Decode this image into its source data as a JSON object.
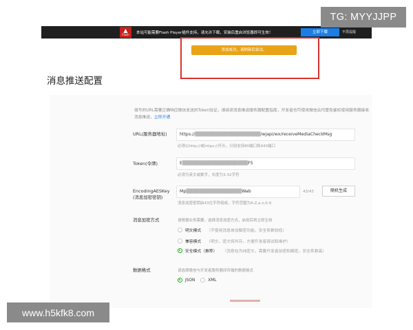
{
  "topbar": {
    "badge_label": "Flash",
    "message": "本站可能需要Flash Player插件支持，请允许下载，安装后重启浏览器即可生效！",
    "update_button": "立即下载",
    "no_remind": "不再提醒"
  },
  "watermark_top": "TG: MYYJJPP",
  "watermark_bottom": "www.h5kfk8.com",
  "notice": "添加成功，请刷新后尝试。",
  "page_title": "消息推送配置",
  "intro": {
    "text": "填写的URL需要正确响应微信发送的Token验证，请阅读消息推送服务器配置指南，开发者也可使用微信云托管免鉴权使用服务器接收消息推送，",
    "link": "立即开通"
  },
  "form": {
    "url": {
      "label": "URL(服务器地址)",
      "value_prefix": "https://",
      "value_suffix": "/wjapi/wx/receiveMediaCheckMsg",
      "hint": "必须以http://或https://开头，分别支持80端口和443端口"
    },
    "token": {
      "label": "Token(令牌)",
      "value_prefix": "E",
      "value_suffix": "F5",
      "hint": "必须为英文或数字，长度为3-32字符"
    },
    "aeskey": {
      "label_line1": "EncodingAESKey",
      "label_line2": "(消息加密密钥)",
      "value_prefix": "Mp",
      "value_suffix": "Wab",
      "counter": "43/43",
      "generate_button": "随机生成",
      "hint": "消息加密密钥由43位字符组成，字符范围为A-Z,a-z,0-9"
    },
    "encrypt_mode": {
      "label": "消息加密方式",
      "hint": "请根据业务需要，选择消息加密方式，启用后将立即生效",
      "options": [
        {
          "name": "明文模式",
          "desc": "（不使用消息体加解密功能，安全系数较低）",
          "selected": false
        },
        {
          "name": "兼容模式",
          "desc": "（明文、密文将共存，方便开发者调试和维护）",
          "selected": false
        },
        {
          "name": "安全模式（推荐）",
          "desc": "（消息包为纯密文，需要开发者加密和解密，安全系数高）",
          "selected": true
        }
      ]
    },
    "data_format": {
      "label": "数据格式",
      "hint": "请选择微信与开发者服务器间传输的数据格式",
      "options": [
        {
          "name": "JSON",
          "selected": true
        },
        {
          "name": "XML",
          "selected": false
        }
      ]
    }
  },
  "colors": {
    "topbar_bg": "#1f1f1f",
    "warn_red": "#c6211a",
    "update_blue": "#1a7ee6",
    "notice_orange": "#e8a317",
    "highlight_red": "#d9302c",
    "radio_green": "#1aad19",
    "link_blue": "#2f7fd8"
  }
}
